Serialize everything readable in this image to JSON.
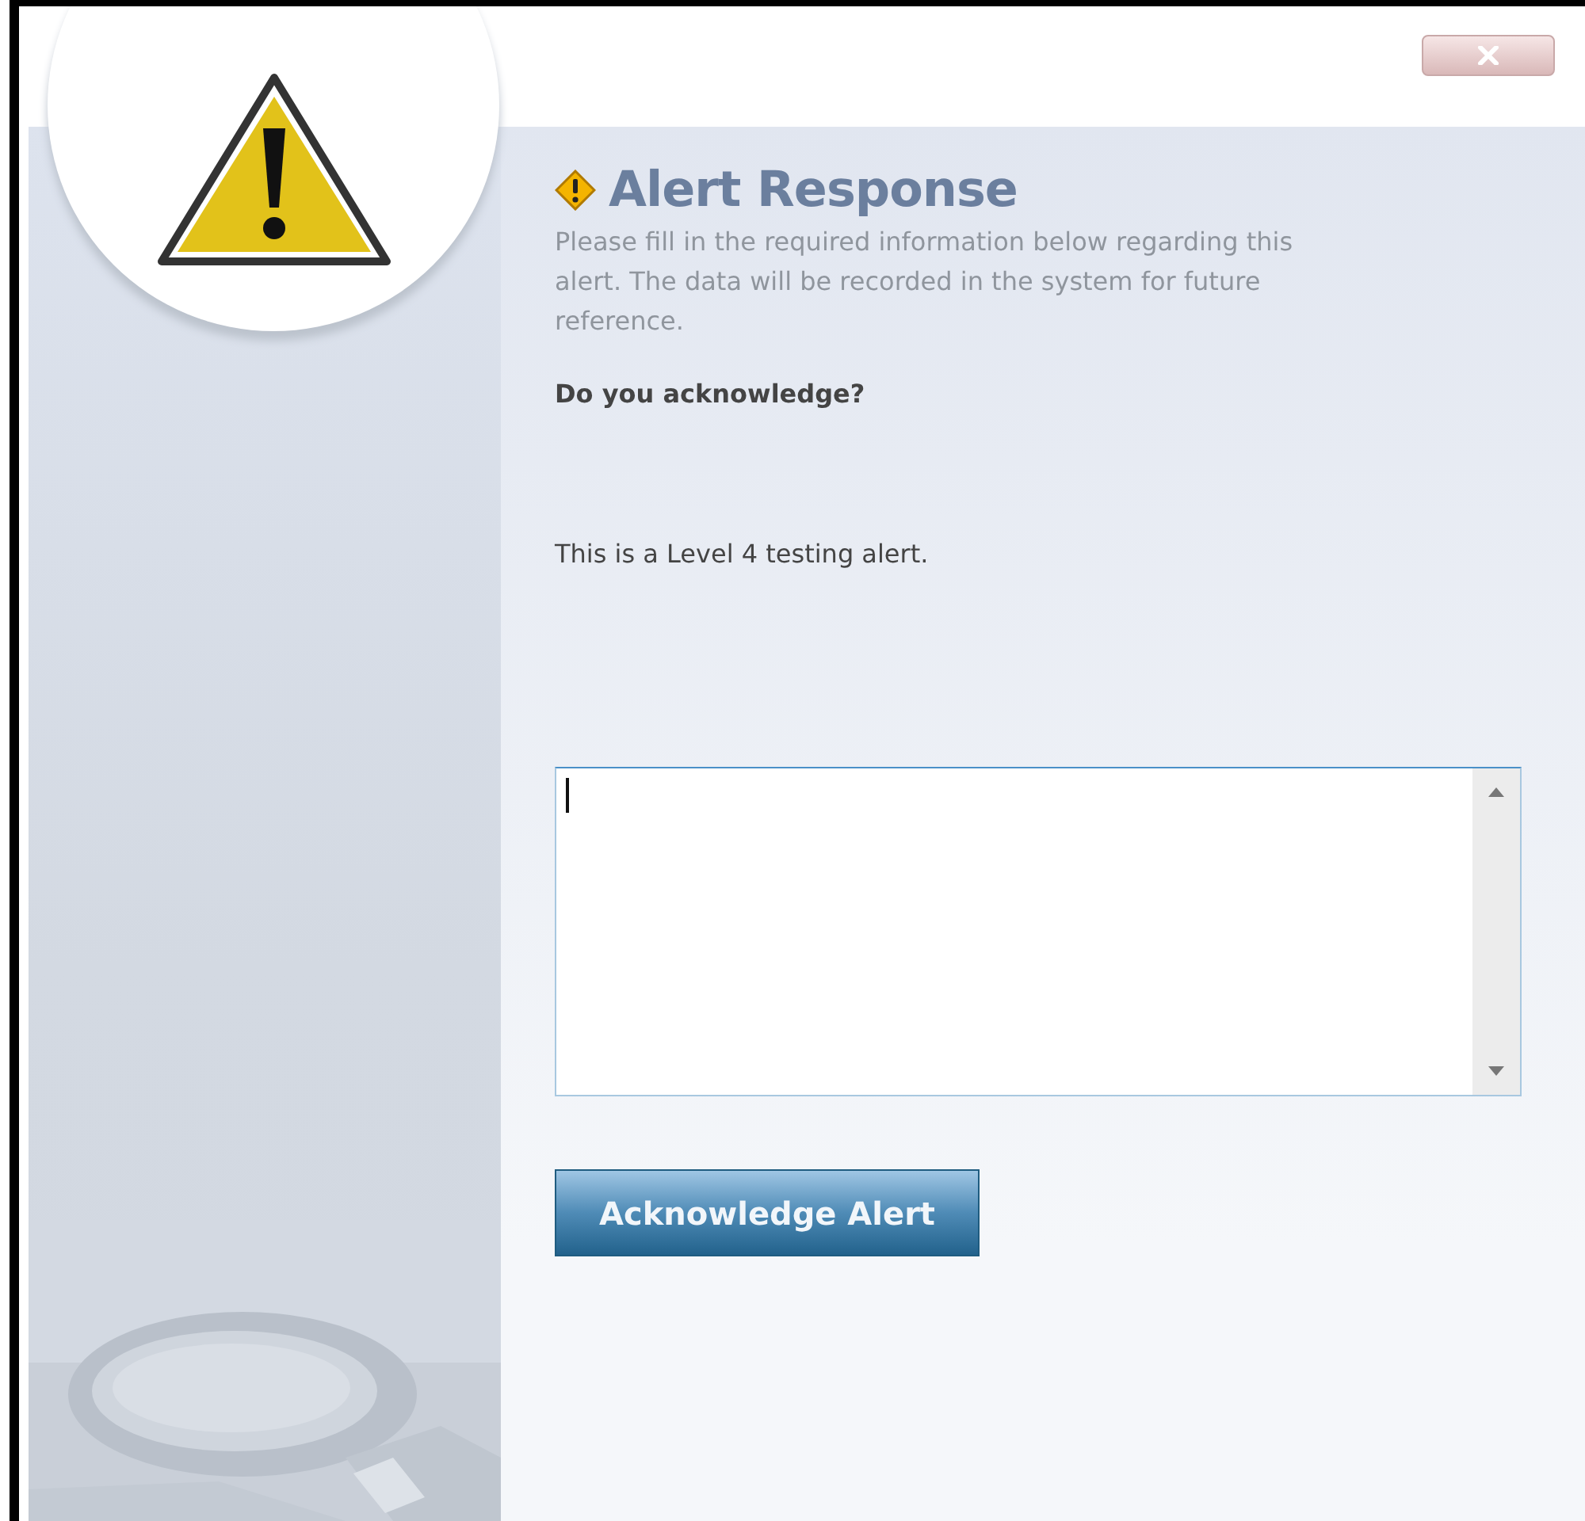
{
  "dialog": {
    "title": "Alert Response",
    "description": "Please fill in the required information below regarding this alert. The data will be recorded in the system for future reference.",
    "question": "Do you acknowledge?",
    "message": "This is a Level 4 testing alert.",
    "response_field": {
      "focused": true
    },
    "submit_button": "Acknowledge Alert"
  }
}
